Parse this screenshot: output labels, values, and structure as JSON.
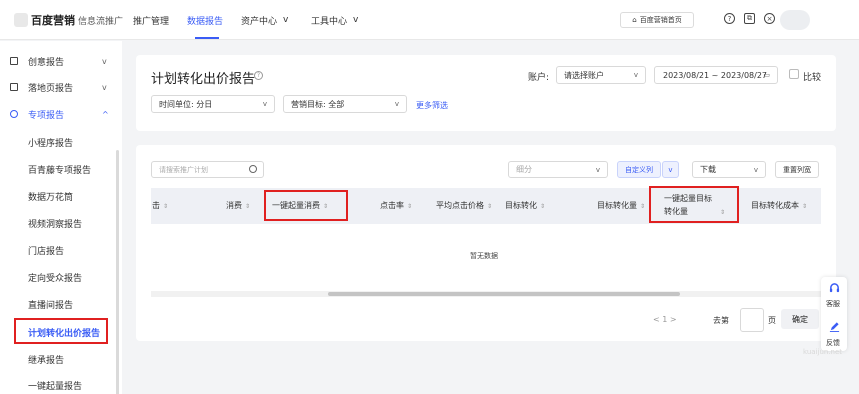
{
  "topbar": {
    "logo_main": "百度营销",
    "logo_sub": "信息流推广",
    "nav": [
      {
        "label": "推广管理"
      },
      {
        "label": "数据报告"
      },
      {
        "label": "资产中心"
      },
      {
        "label": "工具中心"
      }
    ],
    "home_button": "百度营销首页",
    "icons": [
      "help-circle-icon",
      "copy-icon",
      "close-circle-icon"
    ]
  },
  "sidebar": {
    "items": [
      {
        "label": "创意报告",
        "icon": "document-icon",
        "chevron": "v"
      },
      {
        "label": "落地页报告",
        "icon": "page-icon",
        "chevron": "v"
      },
      {
        "label": "专项报告",
        "icon": "special-icon",
        "chevron": "^"
      }
    ],
    "subitems": [
      {
        "label": "小程序报告"
      },
      {
        "label": "百青藤专项报告"
      },
      {
        "label": "数据万花筒"
      },
      {
        "label": "视频洞察报告"
      },
      {
        "label": "门店报告"
      },
      {
        "label": "定向受众报告"
      },
      {
        "label": "直播间报告"
      },
      {
        "label": "计划转化出价报告"
      },
      {
        "label": "继承报告"
      },
      {
        "label": "一键起量报告"
      }
    ]
  },
  "filters": {
    "title": "计划转化出价报告",
    "account_label": "账户:",
    "account_placeholder": "请选择账户",
    "date_range": "2023/08/21 ~ 2023/08/27",
    "compare_label": "比较",
    "time_unit": "时间单位: 分日",
    "marketing_goal": "营销目标: 全部",
    "more_filters": "更多筛选"
  },
  "table": {
    "search_placeholder": "请搜索推广计划",
    "breakdown_placeholder": "细分",
    "custom_columns": "自定义列",
    "download": "下载",
    "reset_columns": "重置列宽",
    "columns": [
      {
        "label": "击"
      },
      {
        "label": "消费"
      },
      {
        "label": "一键起量消费"
      },
      {
        "label": "点击率"
      },
      {
        "label": "平均点击价格"
      },
      {
        "label": "目标转化"
      },
      {
        "label": "目标转化量"
      },
      {
        "label": "一键起量目标",
        "label2": "转化量"
      },
      {
        "label": "目标转化成本"
      }
    ],
    "empty_text": "暂无数据",
    "sort_symbol": "⇕"
  },
  "pagination": {
    "range": "< 1 >",
    "goto_label": "去第",
    "page_label": "页",
    "confirm": "确定"
  },
  "float_panel": {
    "service_label": "客服",
    "feedback_label": "反馈"
  },
  "watermark": "kuaijun.net",
  "colors": {
    "accent": "#3a5cf5",
    "highlight_red": "#e02020"
  }
}
